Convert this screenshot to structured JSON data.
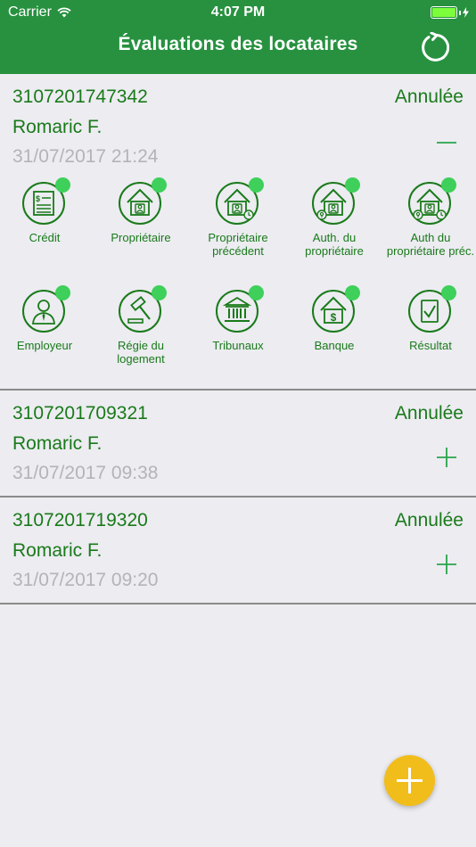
{
  "status_bar": {
    "carrier": "Carrier",
    "time": "4:07 PM"
  },
  "header": {
    "title": "Évaluations des locataires",
    "refresh_icon": "refresh-icon"
  },
  "colors": {
    "header": "#27913f",
    "text_green": "#1a7a1a",
    "dot": "#3ed05a",
    "fab": "#f1bd1a"
  },
  "evaluations": [
    {
      "ref": "3107201747342",
      "status": "Annulée",
      "name": "Romaric F.",
      "date": "31/07/2017 21:24",
      "toggle": "collapse-minus-icon",
      "checks": [
        {
          "label": "Crédit",
          "icon": "credit-report-icon"
        },
        {
          "label": "Propriétaire",
          "icon": "landlord-icon"
        },
        {
          "label": "Propriétaire précédent",
          "icon": "previous-landlord-icon"
        },
        {
          "label": "Auth. du propriétaire",
          "icon": "landlord-auth-icon"
        },
        {
          "label": "Auth du propriétaire préc.",
          "icon": "previous-landlord-auth-icon"
        },
        {
          "label": "Employeur",
          "icon": "employer-icon"
        },
        {
          "label": "Régie du logement",
          "icon": "housing-board-gavel-icon"
        },
        {
          "label": "Tribunaux",
          "icon": "courthouse-icon"
        },
        {
          "label": "Banque",
          "icon": "bank-icon"
        },
        {
          "label": "Résultat",
          "icon": "result-check-icon"
        }
      ]
    },
    {
      "ref": "3107201709321",
      "status": "Annulée",
      "name": "Romaric F.",
      "date": "31/07/2017 09:38",
      "toggle": "expand-plus-icon"
    },
    {
      "ref": "3107201719320",
      "status": "Annulée",
      "name": "Romaric F.",
      "date": "31/07/2017 09:20",
      "toggle": "expand-plus-icon"
    }
  ],
  "fab": {
    "icon": "add-plus-icon"
  }
}
